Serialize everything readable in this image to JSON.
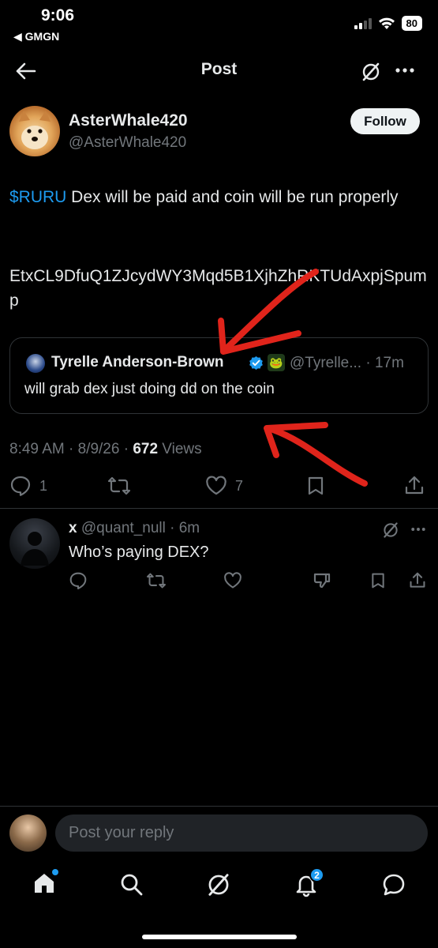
{
  "status_bar": {
    "time": "9:06",
    "back_app": "◀ GMGN",
    "battery": "80"
  },
  "header": {
    "title": "Post"
  },
  "post": {
    "author_name": "AsterWhale420",
    "author_handle": "@AsterWhale420",
    "follow_label": "Follow",
    "cashtag": "$RURU",
    "text": " Dex will be paid and coin will be run properly",
    "address": "EtxCL9DfuQ1ZJcydWY3Mqd5B1XjhZhRKTUdAxpjSpump",
    "time": "8:49 AM · 8/9/26 · ",
    "views_count": "672",
    "views_label": " Views",
    "reply_count": "1",
    "like_count": "7"
  },
  "quote": {
    "name": "Tyrelle Anderson-Brown",
    "handle_time": "@Tyrelle... · 17m",
    "text": "will grab dex just doing dd on the coin"
  },
  "reply": {
    "name": "x",
    "handle_time": " @quant_null · 6m",
    "text": "Who’s paying DEX?"
  },
  "composer": {
    "placeholder": "Post your reply"
  },
  "tabbar": {
    "notifications_badge": "2"
  },
  "colors": {
    "accent": "#1d9bf0",
    "annotation_red": "#e0241b",
    "background": "#000000",
    "muted": "#71767b"
  },
  "icons": [
    "back-arrow-icon",
    "grok-icon",
    "more-icon",
    "verified-badge-icon",
    "reply-icon",
    "repost-icon",
    "like-icon",
    "bookmark-icon",
    "share-icon",
    "dislike-icon",
    "home-icon",
    "search-icon",
    "notifications-icon",
    "messages-icon"
  ]
}
